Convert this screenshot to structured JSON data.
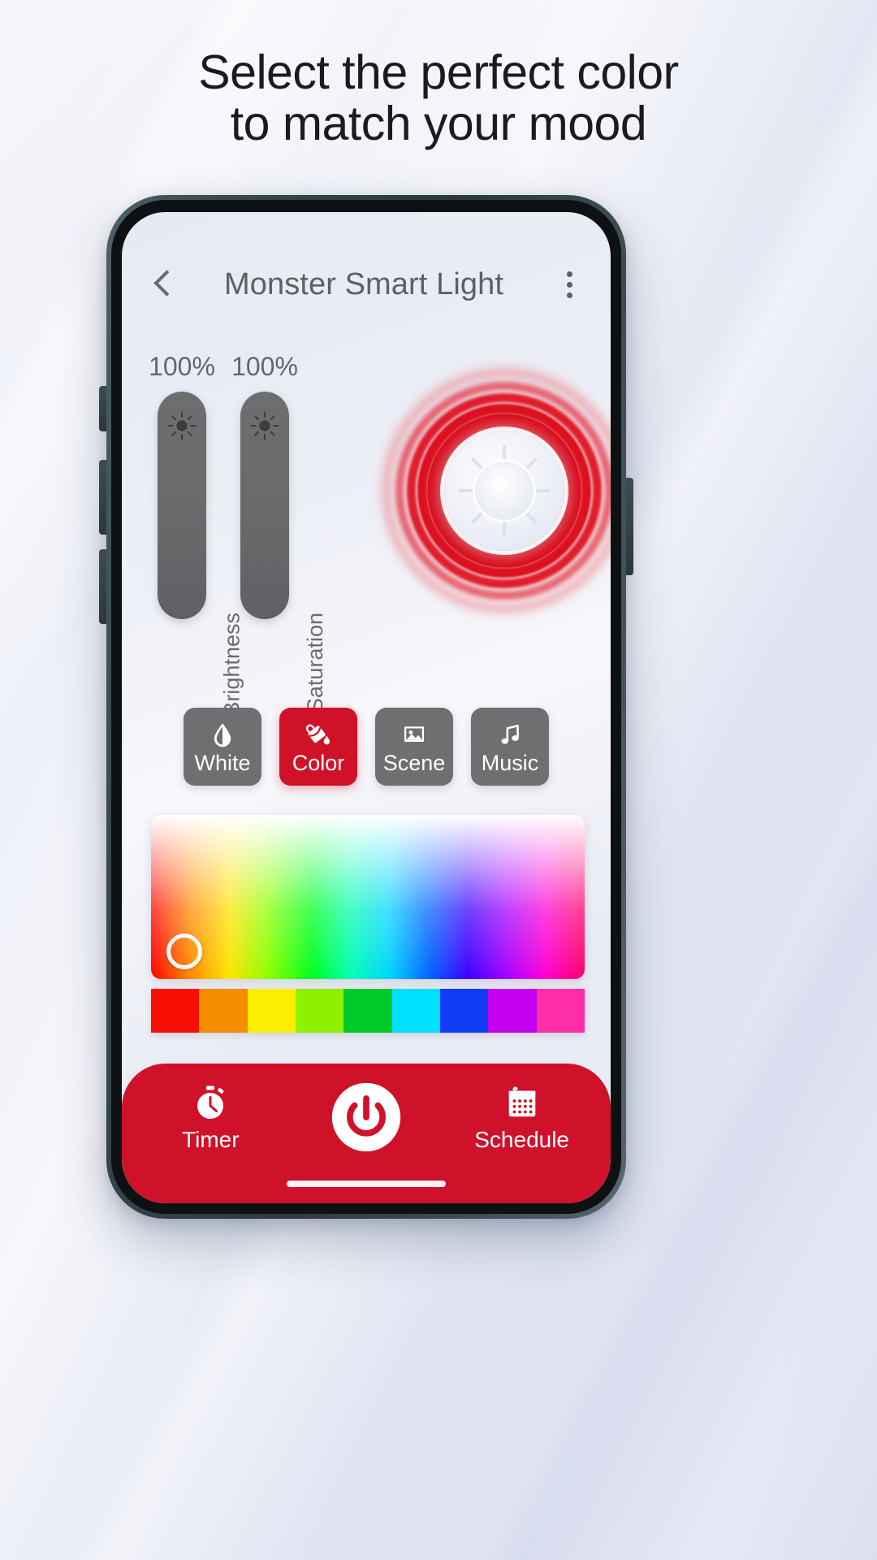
{
  "headline": {
    "line1": "Select the perfect color",
    "line2": "to match your mood"
  },
  "app": {
    "header": {
      "back_icon": "back-chevron-icon",
      "title": "Monster Smart Light",
      "menu_icon": "kebab-menu-icon"
    },
    "sliders": [
      {
        "value": "100%",
        "label": "Brightness",
        "icon": "brightness-sun-icon"
      },
      {
        "value": "100%",
        "label": "Saturation",
        "icon": "saturation-sun-icon"
      }
    ],
    "bulb": {
      "glow_color": "#d0112a",
      "icon": "light-bulb-glow-graphic"
    },
    "modes": [
      {
        "label": "White",
        "icon": "water-drop-icon",
        "active": false
      },
      {
        "label": "Color",
        "icon": "paint-bucket-icon",
        "active": true
      },
      {
        "label": "Scene",
        "icon": "image-picture-icon",
        "active": false
      },
      {
        "label": "Music",
        "icon": "music-note-icon",
        "active": false
      }
    ],
    "color_picker": {
      "cursor_icon": "color-cursor-ring",
      "swatches": [
        "#fa0f07",
        "#f68c00",
        "#fcee00",
        "#8ef100",
        "#00c92a",
        "#00e0ff",
        "#0f3ef5",
        "#c400f0",
        "#ff2ea8"
      ]
    },
    "bottom_nav": {
      "background_color": "#d0112a",
      "items": [
        {
          "label": "Timer",
          "icon": "stopwatch-timer-icon"
        },
        {
          "label": "Schedule",
          "icon": "calendar-schedule-icon"
        }
      ],
      "power": {
        "icon": "power-button-icon"
      }
    }
  },
  "theme": {
    "accent": "#d0112a",
    "slider_gray": "#6d6e70",
    "text_gray": "#5f6066"
  }
}
